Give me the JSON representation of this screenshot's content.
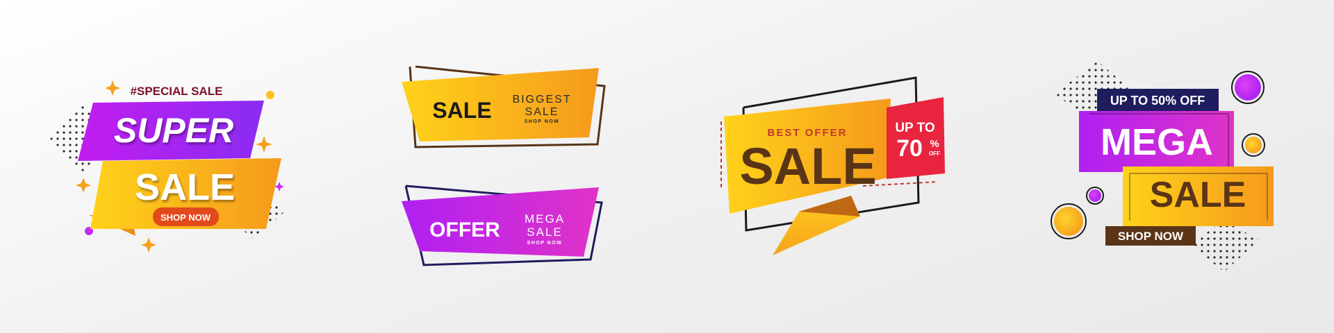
{
  "banner1": {
    "tag": "#SPECIAL SALE",
    "line1": "SUPER",
    "line2": "SALE",
    "cta": "SHOP NOW"
  },
  "banner2": {
    "main": "SALE",
    "sub_line1": "BIGGEST",
    "sub_line2": "SALE",
    "cta": "SHOP NOW"
  },
  "banner3": {
    "main": "OFFER",
    "sub_line1": "MEGA",
    "sub_line2": "SALE",
    "cta": "SHOP NOW"
  },
  "banner4": {
    "kicker": "BEST OFFER",
    "main": "SALE",
    "badge_line1": "UP TO",
    "badge_value": "70",
    "badge_percent": "%",
    "badge_off": "OFF"
  },
  "banner5": {
    "top": "UP TO 50% OFF",
    "line1": "MEGA",
    "line2": "SALE",
    "cta": "SHOP NOW"
  },
  "colors": {
    "purple": "#b31cf0",
    "magenta": "#d42ad6",
    "yellow": "#ffc21c",
    "orange": "#f39a1e",
    "red": "#e8243f",
    "navy": "#1f1d5e",
    "brown": "#5a3416",
    "dark_red": "#7a1028"
  }
}
